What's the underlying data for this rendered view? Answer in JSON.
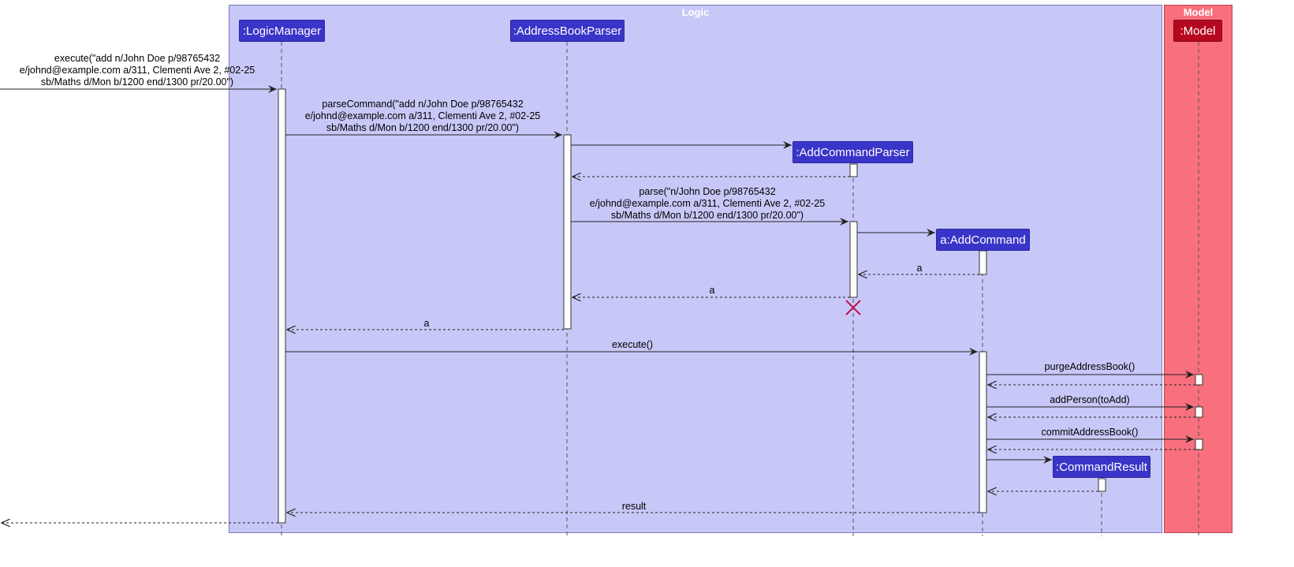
{
  "boxes": {
    "logic": "Logic",
    "model": "Model"
  },
  "participants": {
    "logic_manager": ":LogicManager",
    "address_book_parser": ":AddressBookParser",
    "add_command_parser": ":AddCommandParser",
    "add_command": "a:AddCommand",
    "command_result": ":CommandResult",
    "model": ":Model"
  },
  "messages": {
    "execute_input_1": "execute(\"add n/John Doe p/98765432",
    "execute_input_2": "e/johnd@example.com a/311, Clementi Ave 2, #02-25",
    "execute_input_3": "sb/Maths d/Mon b/1200 end/1300 pr/20.00\")",
    "parse_command_1": "parseCommand(\"add n/John Doe p/98765432",
    "parse_command_2": "e/johnd@example.com a/311, Clementi Ave 2, #02-25",
    "parse_command_3": "sb/Maths d/Mon b/1200 end/1300 pr/20.00\")",
    "parse_1": "parse(\"n/John Doe p/98765432",
    "parse_2": "e/johnd@example.com a/311, Clementi Ave 2, #02-25",
    "parse_3": "sb/Maths d/Mon b/1200 end/1300 pr/20.00\")",
    "return_a_1": "a",
    "return_a_2": "a",
    "return_a_3": "a",
    "execute": "execute()",
    "purge": "purgeAddressBook()",
    "add_person": "addPerson(toAdd)",
    "commit": "commitAddressBook()",
    "result": "result"
  },
  "colors": {
    "logic_fill": "#c8c8f8",
    "logic_border": "#7a7ab8",
    "model_fill": "#f8707e",
    "model_border": "#c04050",
    "participant_logic": "#3a35c8",
    "participant_model": "#b5081e",
    "destroy_mark": "#c0144a"
  }
}
